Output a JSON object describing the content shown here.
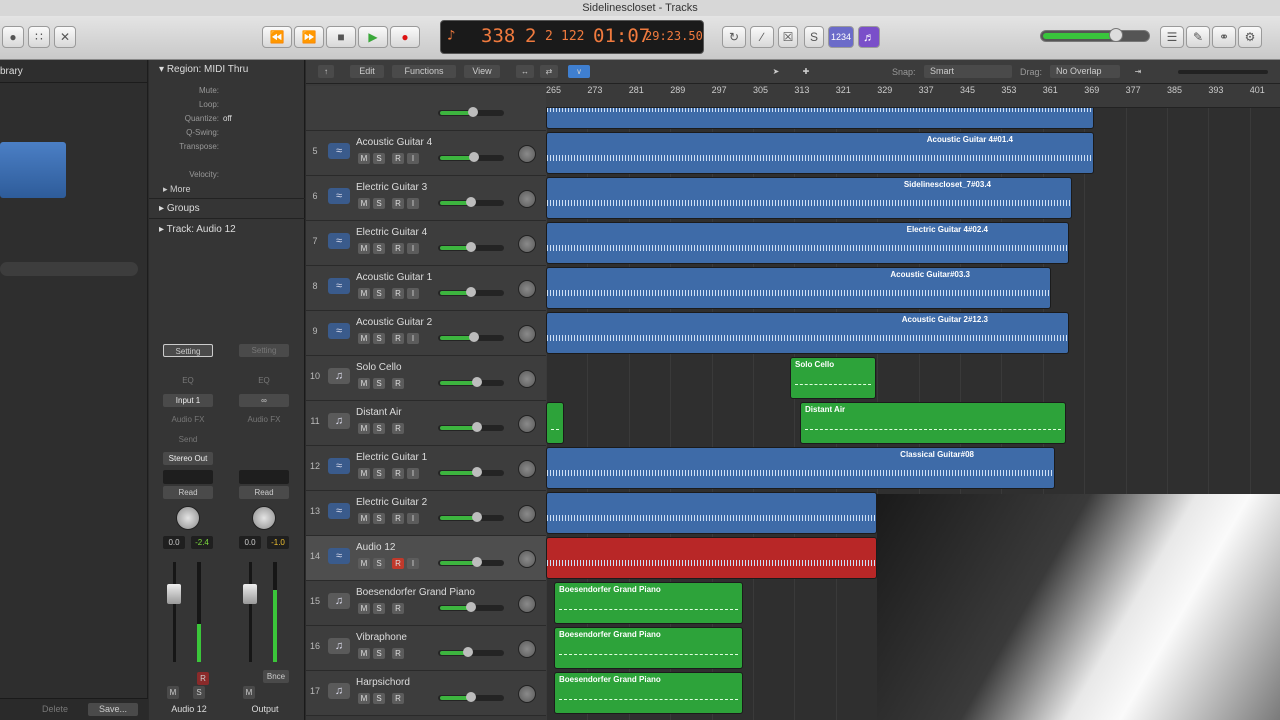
{
  "window": {
    "title": "Sidelinescloset - Tracks"
  },
  "transport": {
    "bar": "338",
    "beat": "2",
    "div": "2",
    "tick": "122",
    "time": "01:07",
    "frames": "29:23.50"
  },
  "library": {
    "label": "brary"
  },
  "inspector": {
    "region_header": "Region: MIDI Thru",
    "rows": [
      "Mute:",
      "Loop:",
      "Quantize:",
      "Q-Swing:",
      "Transpose:",
      "Velocity:"
    ],
    "quantize_value": "off",
    "more": "More",
    "groups": "Groups",
    "track_header": "Track: Audio 12",
    "strip1": {
      "setting": "Setting",
      "eq": "EQ",
      "input": "Input 1",
      "audiofx": "Audio FX",
      "send": "Send",
      "output": "Stereo Out",
      "mode": "Read",
      "vol": "0.0",
      "peak": "-2.4",
      "m": "M",
      "s": "S",
      "r": "R",
      "name": "Audio 12"
    },
    "strip2": {
      "setting": "Setting",
      "eq": "EQ",
      "audiofx": "Audio FX",
      "mode": "Read",
      "vol": "0.0",
      "peak": "-1.0",
      "m": "M",
      "bnce": "Bnce",
      "name": "Output"
    },
    "delete": "Delete",
    "save": "Save..."
  },
  "menu": {
    "edit": "Edit",
    "functions": "Functions",
    "view": "View",
    "snap_label": "Snap:",
    "snap_value": "Smart",
    "drag_label": "Drag:",
    "drag_value": "No Overlap"
  },
  "ruler": [
    "265",
    "273",
    "281",
    "289",
    "297",
    "305",
    "313",
    "321",
    "329",
    "337",
    "345",
    "353",
    "361",
    "369",
    "377",
    "385",
    "393",
    "401"
  ],
  "tracks": [
    {
      "num": "5",
      "name": "Acoustic Guitar 4",
      "kind": "audio",
      "vol": 0.55
    },
    {
      "num": "6",
      "name": "Electric Guitar 3",
      "kind": "audio",
      "vol": 0.5
    },
    {
      "num": "7",
      "name": "Electric Guitar 4",
      "kind": "audio",
      "vol": 0.5
    },
    {
      "num": "8",
      "name": "Acoustic Guitar 1",
      "kind": "audio",
      "vol": 0.5
    },
    {
      "num": "9",
      "name": "Acoustic Guitar 2",
      "kind": "audio",
      "vol": 0.55
    },
    {
      "num": "10",
      "name": "Solo Cello",
      "kind": "inst",
      "vol": 0.6
    },
    {
      "num": "11",
      "name": "Distant Air",
      "kind": "inst",
      "vol": 0.6
    },
    {
      "num": "12",
      "name": "Electric Guitar 1",
      "kind": "audio",
      "vol": 0.6
    },
    {
      "num": "13",
      "name": "Electric Guitar 2",
      "kind": "audio",
      "vol": 0.6
    },
    {
      "num": "14",
      "name": "Audio 12",
      "kind": "audio",
      "vol": 0.6
    },
    {
      "num": "15",
      "name": "Boesendorfer Grand Piano",
      "kind": "inst",
      "vol": 0.5
    },
    {
      "num": "16",
      "name": "Vibraphone",
      "kind": "inst",
      "vol": 0.45
    },
    {
      "num": "17",
      "name": "Harpsichord",
      "kind": "inst",
      "vol": 0.5
    }
  ],
  "regions": [
    {
      "row": -1,
      "name": "",
      "type": "audio",
      "start": 0,
      "end": 548
    },
    {
      "row": 0,
      "name": "Acoustic Guitar 4#01.4",
      "type": "audio",
      "start": 0,
      "end": 548
    },
    {
      "row": 1,
      "name": "Sidelinescloset_7#03.4",
      "type": "audio",
      "start": 0,
      "end": 526
    },
    {
      "row": 2,
      "name": "Electric Guitar 4#02.4",
      "type": "audio",
      "start": 0,
      "end": 523
    },
    {
      "row": 3,
      "name": "Acoustic Guitar#03.3",
      "type": "audio",
      "start": 0,
      "end": 505
    },
    {
      "row": 4,
      "name": "Acoustic Guitar 2#12.3",
      "type": "audio",
      "start": 0,
      "end": 523
    },
    {
      "row": 5,
      "name": "Solo Cello",
      "type": "midi",
      "start": 244,
      "end": 330
    },
    {
      "row": 6,
      "name": "",
      "type": "midi",
      "start": 0,
      "end": 18
    },
    {
      "row": 6,
      "name": "Distant Air",
      "type": "midi",
      "start": 254,
      "end": 520
    },
    {
      "row": 7,
      "name": "Classical Guitar#08",
      "type": "audio",
      "start": 0,
      "end": 509
    },
    {
      "row": 8,
      "name": "",
      "type": "audio",
      "start": 0,
      "end": 331
    },
    {
      "row": 9,
      "name": "",
      "type": "rec",
      "start": 0,
      "end": 331
    },
    {
      "row": 10,
      "name": "Boesendorfer Grand Piano",
      "type": "midi",
      "start": 8,
      "end": 197
    },
    {
      "row": 11,
      "name": "Boesendorfer Grand Piano",
      "type": "midi",
      "start": 8,
      "end": 197
    },
    {
      "row": 12,
      "name": "Boesendorfer Grand Piano",
      "type": "midi",
      "start": 8,
      "end": 197
    }
  ]
}
